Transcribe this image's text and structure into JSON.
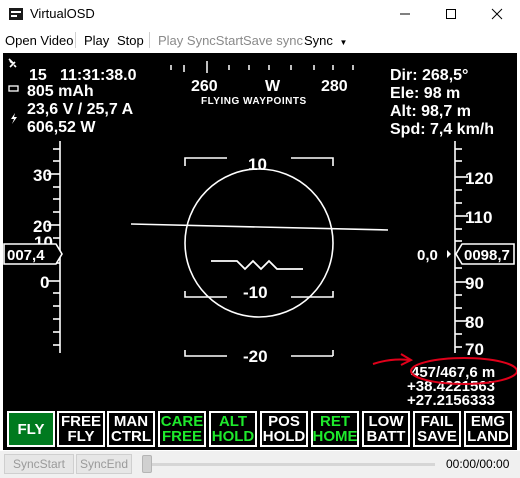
{
  "window": {
    "title": "VirtualOSD"
  },
  "menu": {
    "open_video": "Open Video",
    "play": "Play",
    "stop": "Stop",
    "play_syncstart": "Play SyncStart",
    "save_sync": "Save sync",
    "sync": "Sync"
  },
  "osd": {
    "left_info": {
      "sats": "15",
      "time": "11:31:38.0",
      "capacity": "805 mAh",
      "power": "23,6 V / 25,7 A",
      "watts": "606,52 W"
    },
    "right_info": {
      "dir": "Dir: 268,5°",
      "ele": "Ele: 98 m",
      "alt": "Alt: 98,7 m",
      "spd": "Spd: 7,4 km/h"
    },
    "heading": {
      "ticks": [
        "260",
        "W",
        "280"
      ],
      "mode_text": "FLYING WAYPOINTS"
    },
    "left_scale": [
      "30",
      "20",
      "10",
      "0"
    ],
    "left_value": "007,4",
    "right_scale": [
      "120",
      "110",
      "90",
      "80",
      "70"
    ],
    "right_value": "0098,7",
    "vario": "0,0",
    "pitch": [
      "10",
      "-10",
      "-20"
    ],
    "distance": "457/467,6 m",
    "lat": "+38.4221563",
    "lon": "+27.2156333",
    "annotation_color": "#e0001a"
  },
  "modes": [
    {
      "l1": "FLY",
      "l2": "",
      "state": "active"
    },
    {
      "l1": "FREE",
      "l2": "FLY",
      "state": "normal"
    },
    {
      "l1": "MAN",
      "l2": "CTRL",
      "state": "normal"
    },
    {
      "l1": "CARE",
      "l2": "FREE",
      "state": "green"
    },
    {
      "l1": "ALT",
      "l2": "HOLD",
      "state": "green"
    },
    {
      "l1": "POS",
      "l2": "HOLD",
      "state": "normal"
    },
    {
      "l1": "RET",
      "l2": "HOME",
      "state": "green"
    },
    {
      "l1": "LOW",
      "l2": "BATT",
      "state": "normal"
    },
    {
      "l1": "FAIL",
      "l2": "SAVE",
      "state": "normal"
    },
    {
      "l1": "EMG",
      "l2": "LAND",
      "state": "normal"
    }
  ],
  "bottom": {
    "syncstart": "SyncStart",
    "syncend": "SyncEnd",
    "time": "00:00/00:00"
  }
}
